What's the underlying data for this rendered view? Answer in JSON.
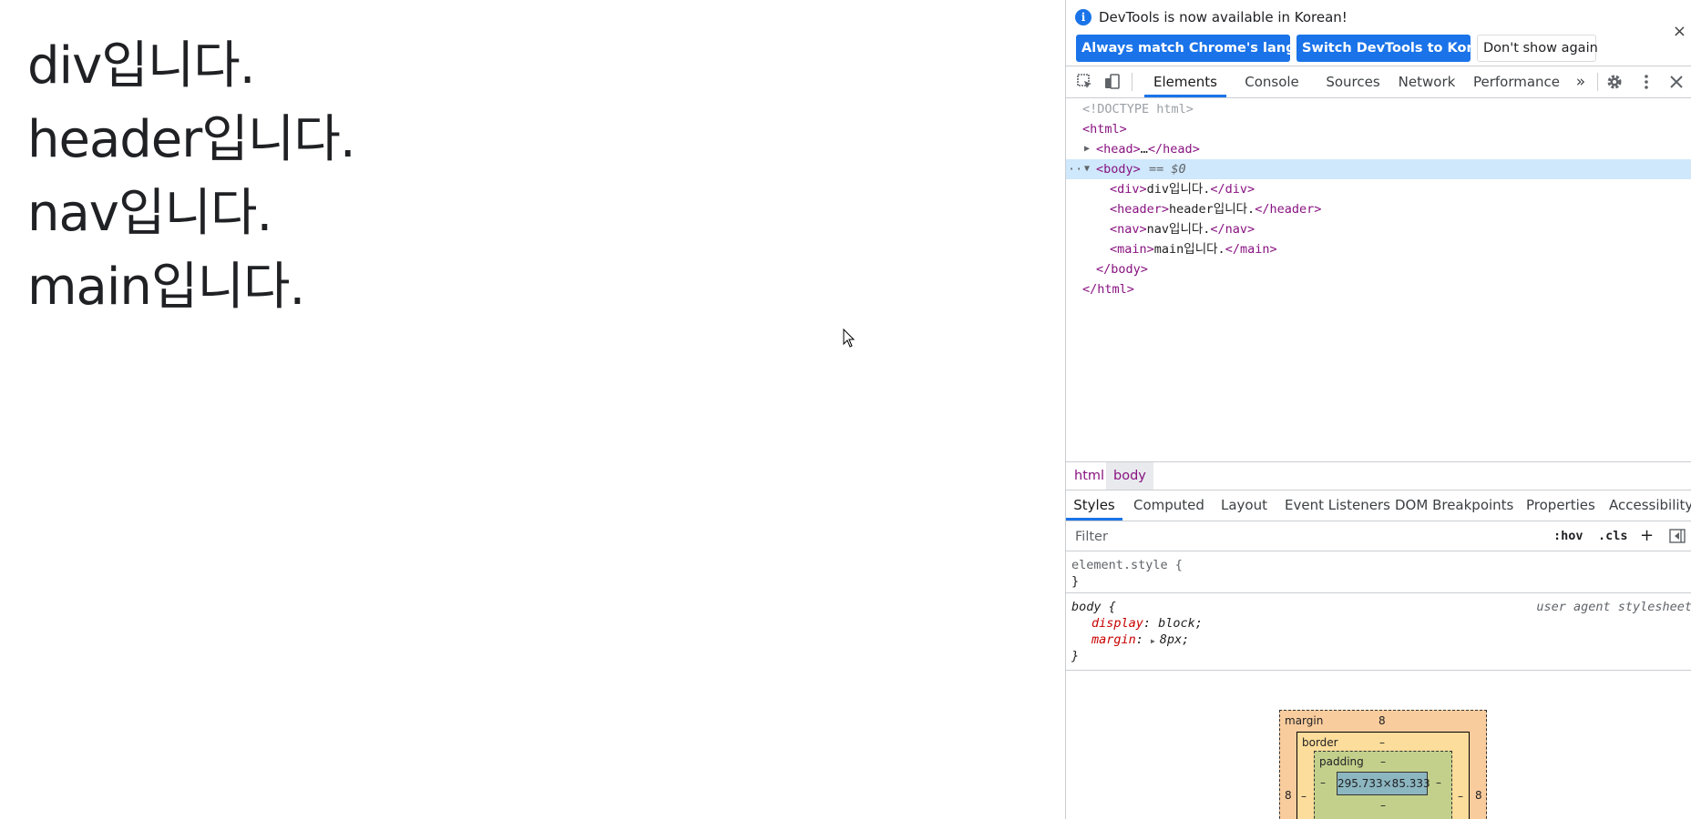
{
  "page": {
    "lines": [
      "div입니다.",
      "header입니다.",
      "nav입니다.",
      "main입니다."
    ]
  },
  "devtools": {
    "infobar": {
      "message": "DevTools is now available in Korean!",
      "btn_match": "Always match Chrome's language",
      "btn_switch": "Switch DevTools to Korean",
      "btn_dont_show": "Don't show again",
      "close": "×"
    },
    "tabs": [
      "Elements",
      "Console",
      "Sources",
      "Network",
      "Performance"
    ],
    "more_tabs": "»",
    "dom": {
      "doctype": "<!DOCTYPE html>",
      "html_open": "<html>",
      "head": [
        "<head>",
        "…",
        "</head>"
      ],
      "body_open": "<body>",
      "body_eq": "== $0",
      "rows": [
        {
          "open": "<div>",
          "text": "div입니다.",
          "close": "</div>"
        },
        {
          "open": "<header>",
          "text": "header입니다.",
          "close": "</header>"
        },
        {
          "open": "<nav>",
          "text": "nav입니다.",
          "close": "</nav>"
        },
        {
          "open": "<main>",
          "text": "main입니다.",
          "close": "</main>"
        }
      ],
      "body_close": "</body>",
      "html_close": "</html>",
      "dots": "···"
    },
    "breadcrumbs": [
      "html",
      "body"
    ],
    "styles_tabs": [
      "Styles",
      "Computed",
      "Layout",
      "Event Listeners",
      "DOM Breakpoints",
      "Properties",
      "Accessibility"
    ],
    "filter": {
      "placeholder": "Filter",
      "hov": ":hov",
      "cls": ".cls",
      "plus": "+"
    },
    "rules": {
      "element_style": {
        "selector": "element.style {",
        "close": "}"
      },
      "body": {
        "selector": "body {",
        "origin": "user agent stylesheet",
        "decls": [
          {
            "prop": "display",
            "value": "block;"
          },
          {
            "prop": "margin",
            "value": "8px;"
          }
        ],
        "close": "}"
      }
    },
    "box_model": {
      "margin_label": "margin",
      "margin_top": "8",
      "margin_left": "8",
      "margin_right": "8",
      "border_label": "border",
      "border_top": "–",
      "border_left": "–",
      "border_right": "–",
      "padding_label": "padding",
      "padding_top": "–",
      "padding_left": "–",
      "padding_right": "–",
      "padding_bottom": "–",
      "content": "295.733×85.333"
    }
  }
}
